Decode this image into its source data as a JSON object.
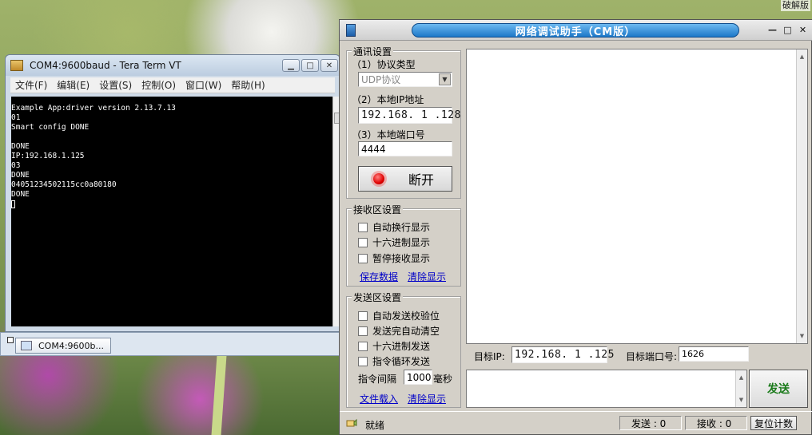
{
  "desktop": {
    "corner_text": "破解版"
  },
  "teraterm": {
    "title": "COM4:9600baud - Tera Term VT",
    "menu": [
      "文件(F)",
      "编辑(E)",
      "设置(S)",
      "控制(O)",
      "窗口(W)",
      "帮助(H)"
    ],
    "terminal_lines": [
      "Example App:driver version 2.13.7.13",
      "01",
      "Smart config DONE",
      "",
      "DONE",
      "IP:192.168.1.125",
      "03",
      "DONE",
      "04051234502115cc0a80180",
      "DONE"
    ],
    "taskbar_label": "COM4:9600b..."
  },
  "netassist": {
    "title": "网络调试助手（CM版）",
    "comm_group": {
      "title": "通讯设置",
      "proto_label": "（1）协议类型",
      "proto_value": "UDP协议",
      "local_ip_label": "（2）本地IP地址",
      "local_ip_value": "192.168. 1 .128",
      "local_port_label": "（3）本地端口号",
      "local_port_value": "4444",
      "disconnect_label": "断开"
    },
    "recv_group": {
      "title": "接收区设置",
      "options": [
        "自动换行显示",
        "十六进制显示",
        "暂停接收显示"
      ],
      "save_link": "保存数据",
      "clear_link": "清除显示"
    },
    "send_group": {
      "title": "发送区设置",
      "options": [
        "自动发送校验位",
        "发送完自动清空",
        "十六进制发送",
        "指令循环发送"
      ],
      "interval_label": "指令间隔",
      "interval_value": "1000",
      "interval_unit": "毫秒",
      "load_link": "文件载入",
      "clear_link": "清除显示"
    },
    "target": {
      "ip_label": "目标IP:",
      "ip_value": "192.168. 1 .125",
      "port_label": "目标端口号:",
      "port_value": "1626"
    },
    "send_button": "发送",
    "status": {
      "ready": "就绪",
      "sent_label": "发送 : 0",
      "recv_label": "接收 : 0",
      "reset_label": "复位计数"
    }
  }
}
